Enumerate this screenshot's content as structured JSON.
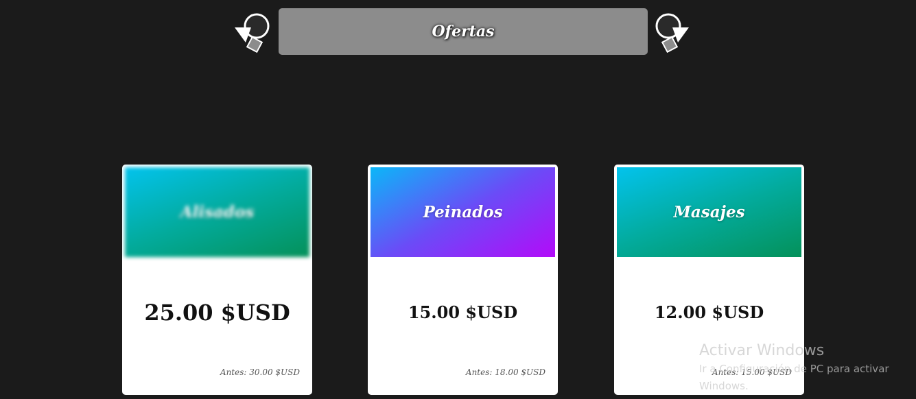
{
  "header": {
    "title": "Ofertas",
    "prev_icon": "rotate-left-arrow-icon",
    "next_icon": "rotate-right-arrow-icon"
  },
  "cards": [
    {
      "title": "Alisados",
      "price": "25.00 $USD",
      "old_price": "Antes: 30.00 $USD",
      "gradient": [
        "#03c3ed",
        "#04915a"
      ]
    },
    {
      "title": "Peinados",
      "price": "15.00 $USD",
      "old_price": "Antes: 18.00 $USD",
      "gradient": [
        "#0bb7f8",
        "#b30bf9"
      ]
    },
    {
      "title": "Masajes",
      "price": "12.00 $USD",
      "old_price": "Antes: 15.00 $USD",
      "gradient": [
        "#03c3ed",
        "#04915a"
      ]
    }
  ],
  "watermark": {
    "title": "Activar Windows",
    "subtitle": "Ir a Configuración de PC para activar Windows."
  },
  "colors": {
    "background": "#1b1b1b",
    "title_bar": "#8c8c8c",
    "card": "#ffffff"
  }
}
